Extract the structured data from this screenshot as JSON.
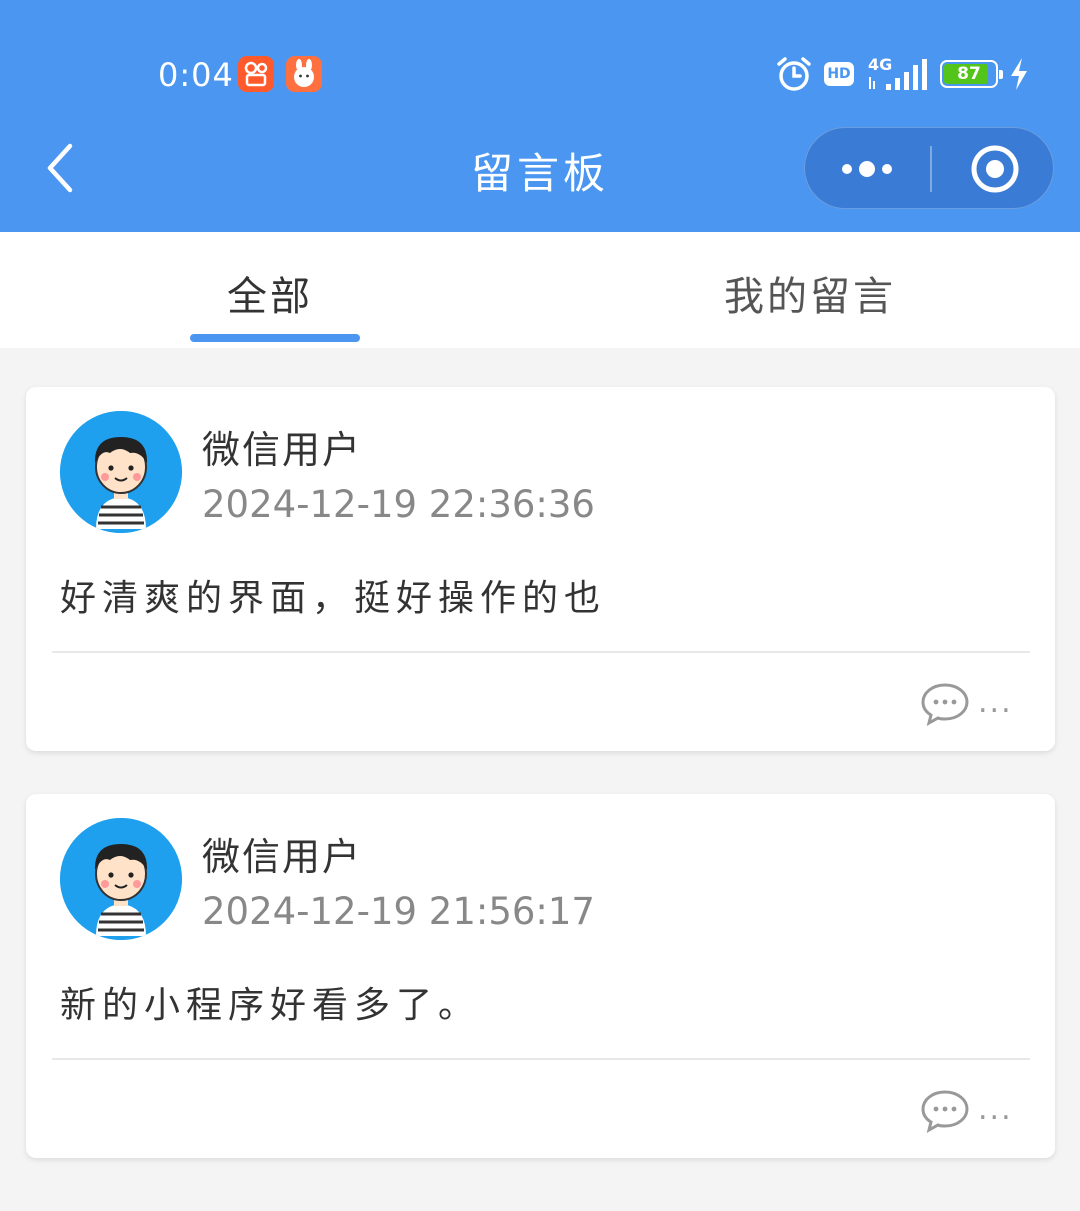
{
  "status_bar": {
    "time": "0:04",
    "network": "4G",
    "hd_label": "HD",
    "battery": "87",
    "battery_level": 0.87,
    "app_icons": [
      "video-app-icon",
      "rabbit-app-icon"
    ],
    "icons": [
      "alarm-icon",
      "signal-icon",
      "charging-icon"
    ]
  },
  "nav": {
    "title": "留言板",
    "back_icon": "back-chevron-icon",
    "more_icon": "more-dots-icon",
    "close_icon": "close-target-icon"
  },
  "tabs": [
    {
      "label": "全部",
      "active": true
    },
    {
      "label": "我的留言",
      "active": false
    }
  ],
  "messages": [
    {
      "user": "微信用户",
      "time": "2024-12-19 22:36:36",
      "content": "好清爽的界面，挺好操作的也",
      "comment_label": "...",
      "comment_icon": "comment-bubble-icon"
    },
    {
      "user": "微信用户",
      "time": "2024-12-19 21:56:17",
      "content": "新的小程序好看多了。",
      "comment_label": "...",
      "comment_icon": "comment-bubble-icon"
    }
  ],
  "colors": {
    "primary": "#4a96f0",
    "avatar_bg": "#1ea0ee",
    "page_bg": "#f4f4f4",
    "battery_green": "#52c41a"
  }
}
